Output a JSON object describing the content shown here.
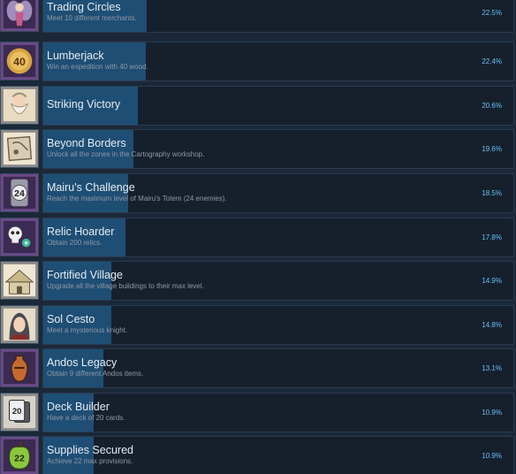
{
  "achievements": [
    {
      "name": "trading-circles",
      "title": "Trading Circles",
      "desc": "Meet 10 different merchants.",
      "pct": "22.5%",
      "value": 22.5,
      "icon": "fairy-merchant-icon",
      "tint": "#6a4a8a"
    },
    {
      "name": "lumberjack",
      "title": "Lumberjack",
      "desc": "Win an expedition with 40 wood.",
      "pct": "22.4%",
      "value": 22.4,
      "icon": "wood-40-badge-icon",
      "tint": "#6a4a8a",
      "badge": "40"
    },
    {
      "name": "striking-victory",
      "title": "Striking Victory",
      "desc": "",
      "pct": "20.6%",
      "value": 20.6,
      "icon": "bearded-old-man-icon",
      "tint": "#8a8a8a"
    },
    {
      "name": "beyond-borders",
      "title": "Beyond Borders",
      "desc": "Unlock all the zones in the Cartography workshop.",
      "pct": "19.6%",
      "value": 19.6,
      "icon": "map-scroll-icon",
      "tint": "#8a8a8a"
    },
    {
      "name": "mairus-challenge",
      "title": "Mairu's Challenge",
      "desc": "Reach the maximum level of Mairu's Totem (24 enemies).",
      "pct": "18.5%",
      "value": 18.5,
      "icon": "totem-24-icon",
      "tint": "#6a4a8a",
      "badge": "24"
    },
    {
      "name": "relic-hoarder",
      "title": "Relic Hoarder",
      "desc": "Obtain 200 relics.",
      "pct": "17.8%",
      "value": 17.8,
      "icon": "skull-relic-icon",
      "tint": "#6a4a8a"
    },
    {
      "name": "fortified-village",
      "title": "Fortified Village",
      "desc": "Upgrade all the village buildings to their max level.",
      "pct": "14.9%",
      "value": 14.9,
      "icon": "village-building-icon",
      "tint": "#8a8a8a"
    },
    {
      "name": "sol-cesto",
      "title": "Sol Cesto",
      "desc": "Meet a mysterious knight.",
      "pct": "14.8%",
      "value": 14.8,
      "icon": "hooded-knight-icon",
      "tint": "#8a8a8a"
    },
    {
      "name": "andos-legacy",
      "title": "Andos Legacy",
      "desc": "Obtain 9 different Andos items.",
      "pct": "13.1%",
      "value": 13.1,
      "icon": "amphora-vase-icon",
      "tint": "#6a4a8a"
    },
    {
      "name": "deck-builder",
      "title": "Deck Builder",
      "desc": "Have a deck of 20 cards.",
      "pct": "10.9%",
      "value": 10.9,
      "icon": "card-deck-20-icon",
      "tint": "#8a8a8a",
      "badge": "20"
    },
    {
      "name": "supplies-secured",
      "title": "Supplies Secured",
      "desc": "Achieve 22 max provisions.",
      "pct": "10.9%",
      "value": 10.9,
      "icon": "green-apple-22-icon",
      "tint": "#6a4a8a",
      "badge": "22"
    }
  ]
}
